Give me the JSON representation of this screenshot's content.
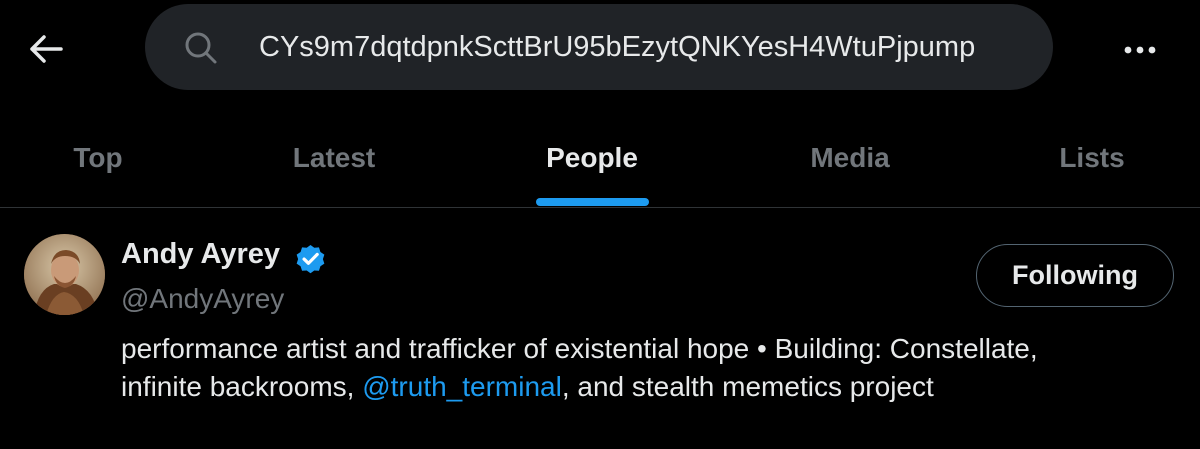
{
  "header": {
    "back_icon": "arrow-left-icon",
    "search_icon": "search-icon",
    "search_value": "CYs9m7dqtdpnkScttBrU95bEzytQNKYesH4WtuPjpump",
    "more_icon": "more-horizontal-icon"
  },
  "tabs": [
    {
      "label": "Top",
      "active": false
    },
    {
      "label": "Latest",
      "active": false
    },
    {
      "label": "People",
      "active": true
    },
    {
      "label": "Media",
      "active": false
    },
    {
      "label": "Lists",
      "active": false
    }
  ],
  "user": {
    "display_name": "Andy Ayrey",
    "verified_icon": "verified-badge-icon",
    "handle": "@AndyAyrey",
    "follow_label": "Following",
    "bio_before": "performance artist and trafficker of existential hope • Building: Constellate,",
    "bio_line2_start": "infinite backrooms, ",
    "bio_mention": "@truth_terminal",
    "bio_end": ", and stealth memetics project"
  },
  "colors": {
    "background": "#000000",
    "accent": "#1d9bf0",
    "text_primary": "#e7e9ea",
    "text_secondary": "#71767b",
    "search_bg": "#202327",
    "border": "#2f3336"
  }
}
